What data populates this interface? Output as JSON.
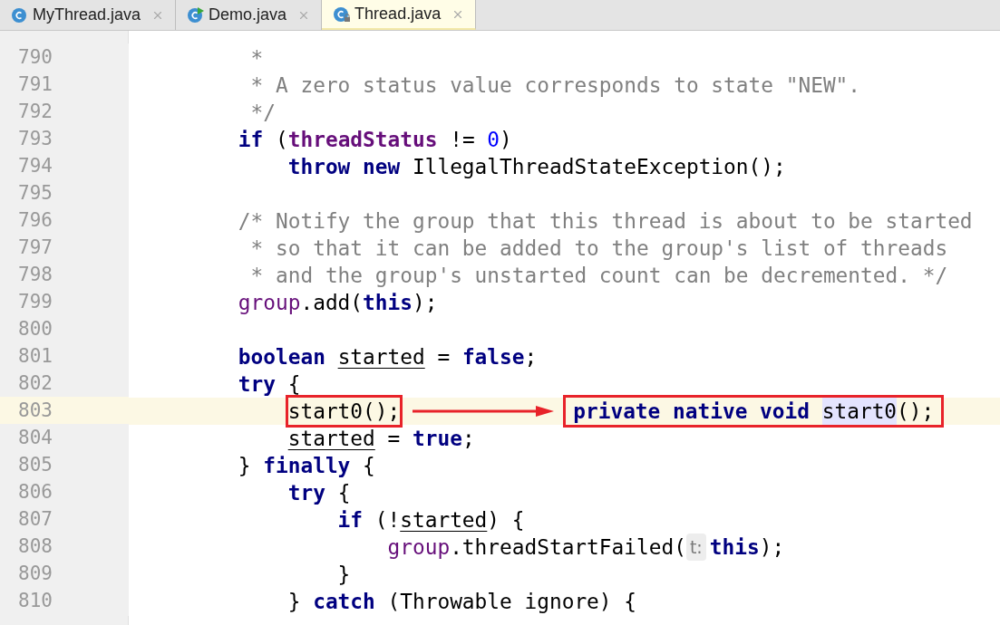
{
  "tabs": [
    {
      "label": "MyThread.java",
      "kind": "class",
      "selected": false
    },
    {
      "label": "Demo.java",
      "kind": "runnable_class",
      "selected": false
    },
    {
      "label": "Thread.java",
      "kind": "locked_class",
      "selected": true
    }
  ],
  "lines": [
    {
      "number": "790",
      "current": false,
      "tokens": [
        {
          "text": "         *",
          "kind": "comment"
        }
      ]
    },
    {
      "number": "791",
      "current": false,
      "tokens": [
        {
          "text": "         * A zero status value corresponds to state \"NEW\".",
          "kind": "comment"
        }
      ]
    },
    {
      "number": "792",
      "current": false,
      "tokens": [
        {
          "text": "         */",
          "kind": "comment"
        }
      ]
    },
    {
      "number": "793",
      "current": false,
      "tokens": [
        {
          "text": "        if",
          "kind": "keyword"
        },
        {
          "text": " (",
          "kind": "plain"
        },
        {
          "text": "threadStatus",
          "kind": "field"
        },
        {
          "text": " != ",
          "kind": "plain"
        },
        {
          "text": "0",
          "kind": "number"
        },
        {
          "text": ")",
          "kind": "plain"
        }
      ]
    },
    {
      "number": "794",
      "current": false,
      "tokens": [
        {
          "text": "            throw new",
          "kind": "keyword"
        },
        {
          "text": " IllegalThreadStateException();",
          "kind": "plain"
        }
      ]
    },
    {
      "number": "795",
      "current": false
    },
    {
      "number": "796",
      "current": false,
      "tokens": [
        {
          "text": "        /* Notify the group that this thread is about to be started",
          "kind": "comment"
        }
      ]
    },
    {
      "number": "797",
      "current": false,
      "tokens": [
        {
          "text": "         * so that it can be added to the group's list of threads",
          "kind": "comment"
        }
      ]
    },
    {
      "number": "798",
      "current": false,
      "tokens": [
        {
          "text": "         * and the group's unstarted count can be decremented. */",
          "kind": "comment"
        }
      ]
    },
    {
      "number": "799",
      "current": false,
      "tokens": [
        {
          "text": "        group",
          "kind": "member"
        },
        {
          "text": ".add(",
          "kind": "plain"
        },
        {
          "text": "this",
          "kind": "keyword"
        },
        {
          "text": ");",
          "kind": "plain"
        }
      ]
    },
    {
      "number": "800",
      "current": false
    },
    {
      "number": "801",
      "current": false,
      "tokens": [
        {
          "text": "        boolean ",
          "kind": "keyword"
        },
        {
          "text": "started",
          "kind": "variable"
        },
        {
          "text": " = ",
          "kind": "plain"
        },
        {
          "text": "false",
          "kind": "keyword"
        },
        {
          "text": ";",
          "kind": "plain"
        }
      ]
    },
    {
      "number": "802",
      "current": false,
      "tokens": [
        {
          "text": "        try",
          "kind": "keyword"
        },
        {
          "text": " {",
          "kind": "plain"
        }
      ]
    },
    {
      "number": "803",
      "current": true,
      "tokens": [
        {
          "text": "            start0();",
          "kind": "boxed"
        }
      ],
      "callout": [
        {
          "text": "private native void ",
          "kind": "keyword"
        },
        {
          "text": "start0",
          "kind": "highlighted"
        },
        {
          "text": "();",
          "kind": "plain"
        }
      ]
    },
    {
      "number": "804",
      "current": false,
      "tokens": [
        {
          "text": "            started",
          "kind": "variable"
        },
        {
          "text": " = ",
          "kind": "plain"
        },
        {
          "text": "true",
          "kind": "keyword"
        },
        {
          "text": ";",
          "kind": "plain"
        }
      ]
    },
    {
      "number": "805",
      "current": false,
      "tokens": [
        {
          "text": "        } ",
          "kind": "plain"
        },
        {
          "text": "finally",
          "kind": "keyword"
        },
        {
          "text": " {",
          "kind": "plain"
        }
      ]
    },
    {
      "number": "806",
      "current": false,
      "tokens": [
        {
          "text": "            try",
          "kind": "keyword"
        },
        {
          "text": " {",
          "kind": "plain"
        }
      ]
    },
    {
      "number": "807",
      "current": false,
      "tokens": [
        {
          "text": "                if",
          "kind": "keyword"
        },
        {
          "text": " (!",
          "kind": "plain"
        },
        {
          "text": "started",
          "kind": "variable"
        },
        {
          "text": ") {",
          "kind": "plain"
        }
      ]
    },
    {
      "number": "808",
      "current": false,
      "tokens": [
        {
          "text": "                    group",
          "kind": "member"
        },
        {
          "text": ".threadStartFailed(",
          "kind": "plain"
        },
        {
          "text": "t:",
          "kind": "hint"
        },
        {
          "text": "this",
          "kind": "keyword"
        },
        {
          "text": ");",
          "kind": "plain"
        }
      ]
    },
    {
      "number": "809",
      "current": false,
      "tokens": [
        {
          "text": "                }",
          "kind": "plain"
        }
      ]
    },
    {
      "number": "810",
      "current": false,
      "tokens": [
        {
          "text": "            } ",
          "kind": "plain"
        },
        {
          "text": "catch",
          "kind": "keyword"
        },
        {
          "text": " (Throwable ignore) {",
          "kind": "plain"
        }
      ]
    }
  ]
}
